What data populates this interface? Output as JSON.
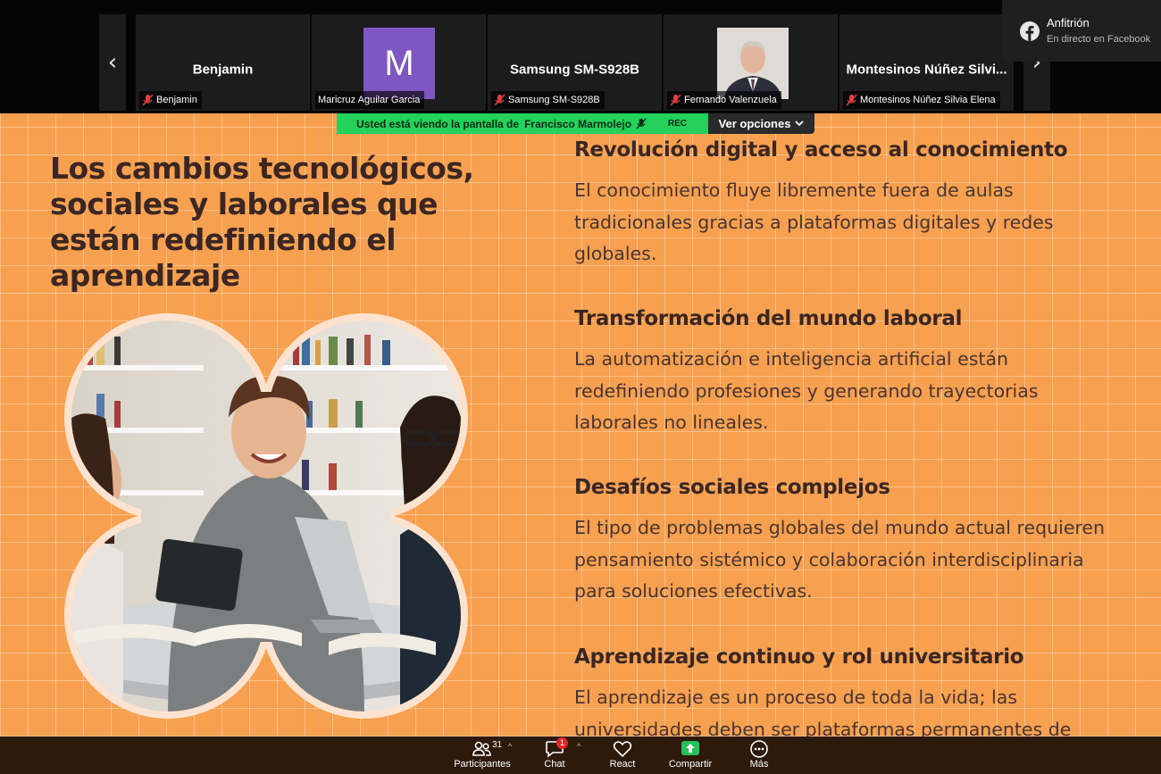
{
  "participants": {
    "tiles": [
      {
        "display": "Benjamin",
        "label": "Benjamin"
      },
      {
        "display": "M",
        "label": "Maricruz Aguilar Garcia"
      },
      {
        "display": "Samsung SM-S928B",
        "label": "Samsung SM-S928B"
      },
      {
        "display": "",
        "label": "Fernando Valenzuela"
      },
      {
        "display": "Montesinos Núñez Silvi...",
        "label": "Montesinos Núñez Silvia Elena"
      }
    ],
    "prev_icon": "chevron-left-icon",
    "next_icon": "chevron-right-icon"
  },
  "facebook_live": {
    "host": "Anfitrión",
    "status": "En directo en Facebook"
  },
  "share_banner": {
    "text": "Usted está viendo la pantalla de",
    "presenter": "Francisco Marmolejo",
    "rec": "REC",
    "view_options": "Ver opciones"
  },
  "slide": {
    "title": "Los cambios tecnológicos, sociales y laborales que están redefiniendo el aprendizaje",
    "sections": [
      {
        "heading": "Revolución digital y acceso al conocimiento",
        "body": "El conocimiento fluye libremente fuera de aulas tradicionales gracias a plataformas digitales y redes globales."
      },
      {
        "heading": "Transformación del mundo laboral",
        "body": "La automatización e inteligencia artificial están redefiniendo profesiones y generando trayectorias laborales no lineales."
      },
      {
        "heading": "Desafíos sociales complejos",
        "body": "El tipo de problemas globales del mundo actual requieren pensamiento sistémico y colaboración interdisciplinaria para soluciones efectivas."
      },
      {
        "heading": "Aprendizaje continuo y rol universitario",
        "body": "El aprendizaje es un proceso de toda la vida; las universidades deben ser plataformas permanentes de formación."
      }
    ],
    "colors": {
      "background": "#f7a050",
      "text": "#3b2622",
      "frame": "#fde3cf"
    }
  },
  "toolbar": {
    "participants": {
      "label": "Participantes",
      "count": "31"
    },
    "chat": {
      "label": "Chat",
      "badge": "1"
    },
    "react": {
      "label": "React"
    },
    "share": {
      "label": "Compartir"
    },
    "more": {
      "label": "Más"
    }
  }
}
